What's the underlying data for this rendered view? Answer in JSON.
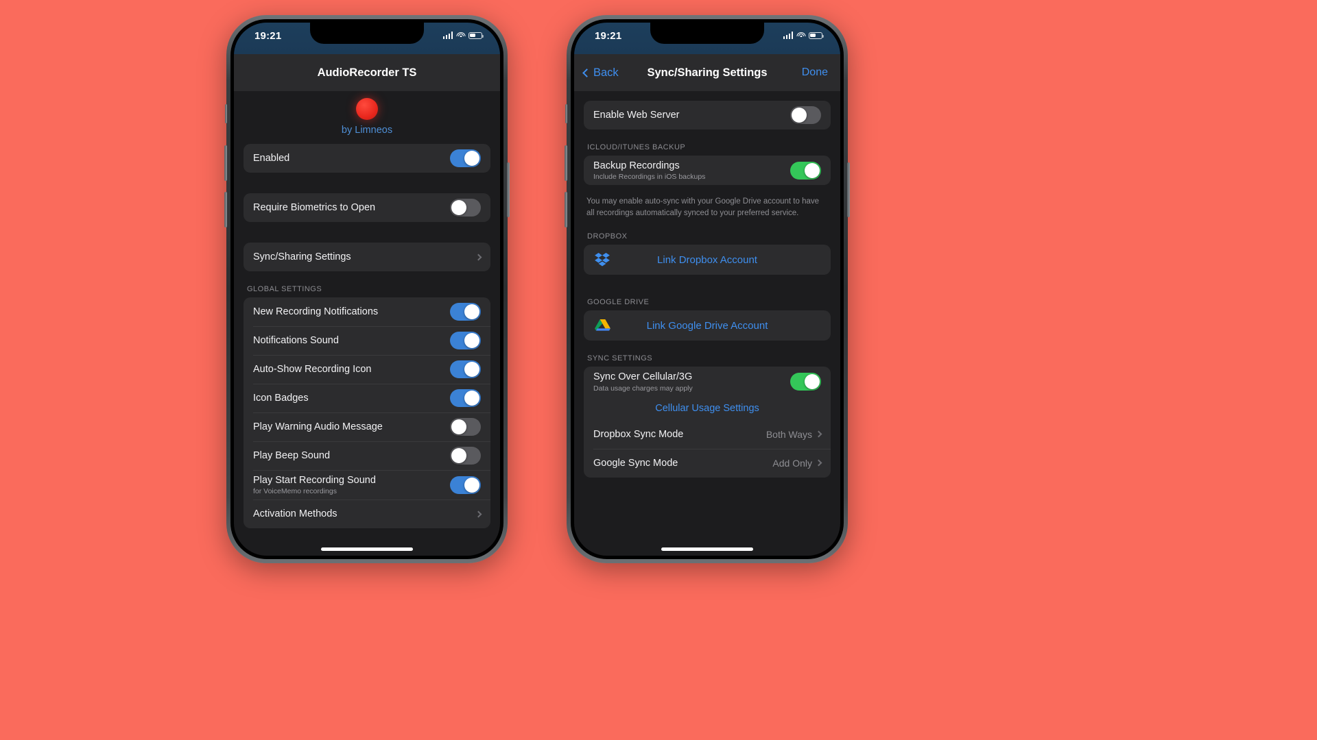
{
  "background_color": "#fa6b5c",
  "colors": {
    "accent_blue": "#3f8fef",
    "toggle_on_blue": "#3b82d6",
    "toggle_on_green": "#34c759",
    "toggle_off_gray": "#5a5a5e",
    "row_bg": "#2c2c2e",
    "screen_bg": "#1c1c1e",
    "record_red": "#e8271d",
    "by_line_blue": "#4f8fd6"
  },
  "phone_left": {
    "status_bar": {
      "time": "19:21",
      "signal_icon": "cellular-signal-icon",
      "wifi_icon": "wifi-icon",
      "battery_icon": "battery-icon"
    },
    "navbar": {
      "title": "AudioRecorder TS"
    },
    "app_header": {
      "icon": "record-dot-icon",
      "byline": "by Limneos"
    },
    "groups": [
      {
        "rows": [
          {
            "label": "Enabled",
            "control": "toggle",
            "state": "on",
            "color": "blue"
          }
        ]
      },
      {
        "rows": [
          {
            "label": "Require Biometrics to Open",
            "control": "toggle",
            "state": "off"
          }
        ]
      },
      {
        "rows": [
          {
            "label": "Sync/Sharing Settings",
            "control": "chevron"
          }
        ]
      }
    ],
    "global_settings": {
      "header": "GLOBAL SETTINGS",
      "rows": [
        {
          "label": "New Recording Notifications",
          "control": "toggle",
          "state": "on",
          "color": "blue"
        },
        {
          "label": "Notifications Sound",
          "control": "toggle",
          "state": "on",
          "color": "blue"
        },
        {
          "label": "Auto-Show Recording Icon",
          "control": "toggle",
          "state": "on",
          "color": "blue"
        },
        {
          "label": "Icon Badges",
          "control": "toggle",
          "state": "on",
          "color": "blue"
        },
        {
          "label": "Play Warning Audio Message",
          "control": "toggle",
          "state": "off"
        },
        {
          "label": "Play Beep Sound",
          "control": "toggle",
          "state": "off"
        },
        {
          "label": "Play Start Recording Sound",
          "sublabel": "for VoiceMemo recordings",
          "control": "toggle",
          "state": "on",
          "color": "blue"
        },
        {
          "label": "Activation Methods",
          "control": "chevron"
        }
      ]
    }
  },
  "phone_right": {
    "status_bar": {
      "time": "19:21",
      "signal_icon": "cellular-signal-icon",
      "wifi_icon": "wifi-icon",
      "battery_icon": "battery-icon"
    },
    "navbar": {
      "back_label": "Back",
      "title": "Sync/Sharing Settings",
      "done_label": "Done"
    },
    "web_server": {
      "rows": [
        {
          "label": "Enable Web Server",
          "control": "toggle",
          "state": "off"
        }
      ]
    },
    "icloud_backup": {
      "header": "ICLOUD/ITUNES BACKUP",
      "rows": [
        {
          "label": "Backup Recordings",
          "sublabel": "Include Recordings in iOS backups",
          "control": "toggle",
          "state": "on",
          "color": "green"
        }
      ]
    },
    "note": "You may enable auto-sync with your Google Drive account to have all recordings automatically synced to your preferred service.",
    "dropbox": {
      "header": "DROPBOX",
      "link_label": "Link Dropbox Account",
      "icon": "dropbox-icon"
    },
    "google_drive": {
      "header": "GOOGLE DRIVE",
      "link_label": "Link Google Drive Account",
      "icon": "google-drive-icon"
    },
    "sync_settings": {
      "header": "SYNC SETTINGS",
      "rows": [
        {
          "label": "Sync Over Cellular/3G",
          "sublabel": "Data usage charges may apply",
          "control": "toggle",
          "state": "on",
          "color": "green"
        }
      ],
      "cellular_usage_link": "Cellular Usage Settings",
      "mode_rows": [
        {
          "label": "Dropbox Sync Mode",
          "value": "Both Ways",
          "control": "chevron"
        },
        {
          "label": "Google Sync Mode",
          "value": "Add Only",
          "control": "chevron"
        }
      ]
    }
  }
}
